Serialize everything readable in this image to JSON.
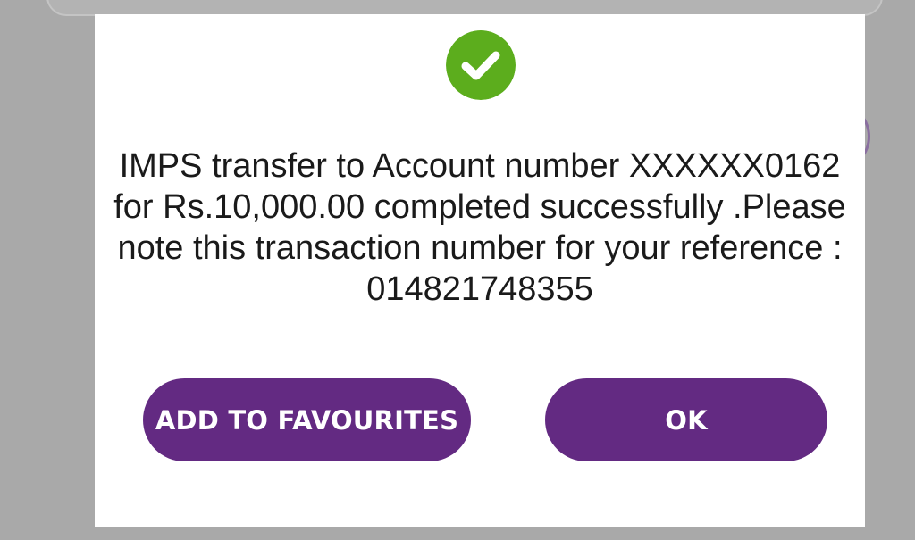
{
  "dialog": {
    "status_icon": "check-circle-icon",
    "message": "IMPS transfer to Account number XXXXXX0162 for Rs.10,000.00 completed successfully .Please note this transaction number for your reference : 014821748355",
    "buttons": {
      "add_to_favourites": "ADD TO FAVOURITES",
      "ok": "OK"
    }
  },
  "colors": {
    "success_green": "#5cad1d",
    "button_purple": "#632a82",
    "overlay_gray": "#a9a9a9"
  }
}
